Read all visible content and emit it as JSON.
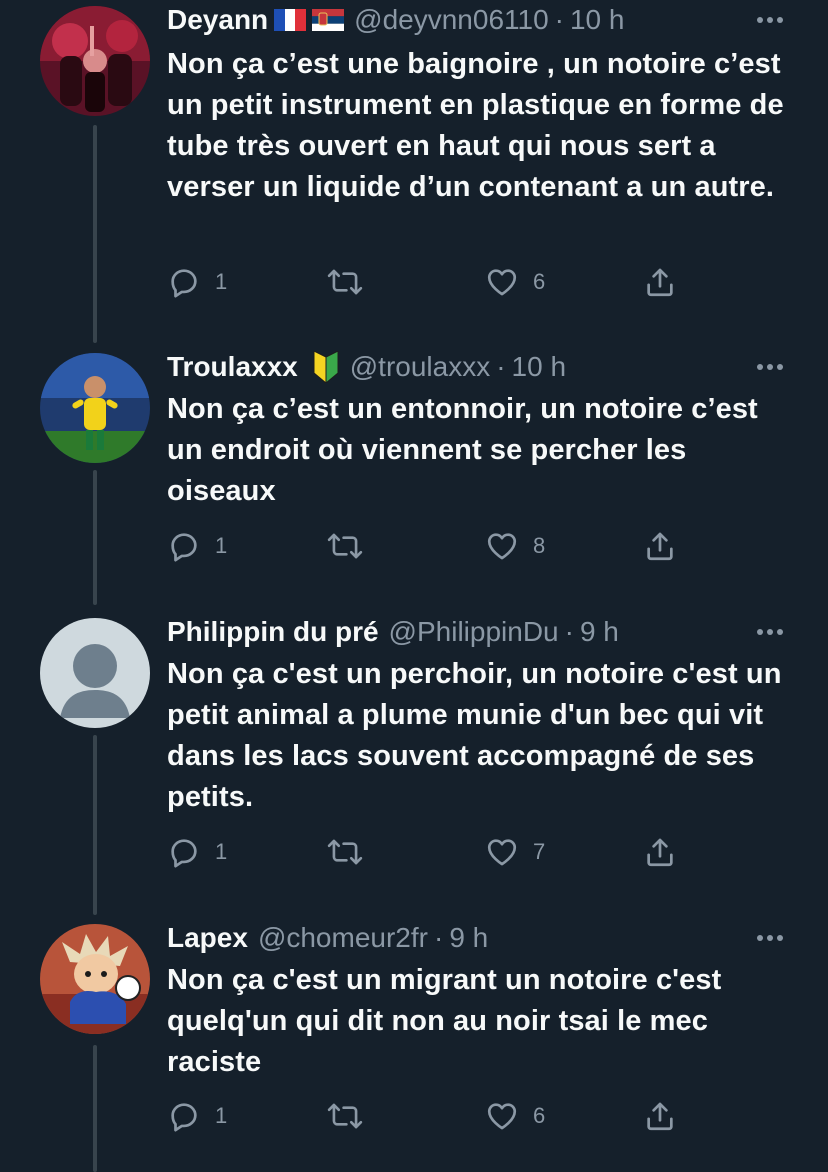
{
  "colors": {
    "background": "#15202b",
    "text_primary": "#f7f9f9",
    "text_secondary": "#8b98a5",
    "thread_line": "#38444d"
  },
  "tweets": [
    {
      "display_name": "Deyann",
      "flags": [
        "flag-france-icon",
        "flag-serbia-icon"
      ],
      "handle": "@deyvnn06110",
      "dot": "·",
      "time": "10 h",
      "text": "Non ça c’est une baignoire , un notoire c’est un petit instrument en plastique en forme de tube très ouvert en haut qui nous sert a verser un liquide d’un contenant a un autre.",
      "replies": "1",
      "retweets": "",
      "likes": "6"
    },
    {
      "display_name": "Troulaxxx",
      "badge": "beginner-badge-icon",
      "handle": "@troulaxxx",
      "dot": "·",
      "time": "10 h",
      "text": "Non ça c’est un entonnoir, un notoire c’est un endroit où viennent se percher les oiseaux",
      "replies": "1",
      "retweets": "",
      "likes": "8"
    },
    {
      "display_name": "Philippin du pré",
      "handle": "@PhilippinDu",
      "dot": "·",
      "time": "9 h",
      "text": "Non ça c'est un perchoir, un notoire c'est un petit animal a plume munie d'un bec qui vit dans les lacs souvent accompagné de ses petits.",
      "replies": "1",
      "retweets": "",
      "likes": "7"
    },
    {
      "display_name": "Lapex",
      "handle": "@chomeur2fr",
      "dot": "·",
      "time": "9 h",
      "text": "Non ça c'est un migrant un notoire c'est quelq'un qui dit non au noir tsai le mec raciste",
      "replies": "1",
      "retweets": "",
      "likes": "6"
    }
  ]
}
